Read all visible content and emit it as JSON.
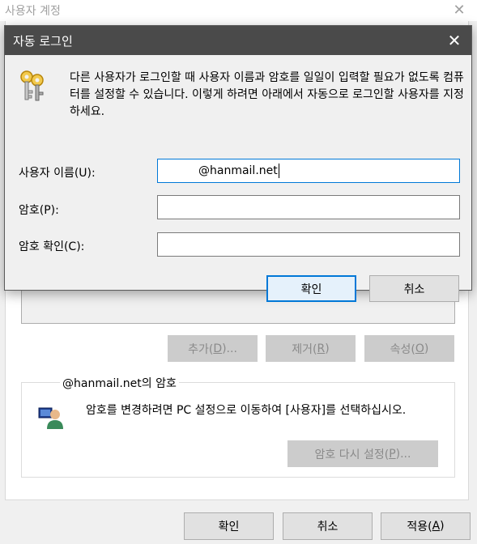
{
  "bg_window": {
    "title": "사용자 계정",
    "close_glyph": "✕",
    "buttons": {
      "add": {
        "label": "추가(",
        "key": "D",
        "suffix": ")..."
      },
      "remove": {
        "label": "제거(",
        "key": "R",
        "suffix": ")"
      },
      "properties": {
        "label": "속성(",
        "key": "O",
        "suffix": ")"
      }
    },
    "password_group": {
      "legend": "@hanmail.net의 암호",
      "text": "암호를 변경하려면 PC 설정으로 이동하여 [사용자]를 선택하십시오.",
      "reset_button": {
        "label": "암호 다시 설정(",
        "key": "P",
        "suffix": ")..."
      }
    },
    "bottom_buttons": {
      "ok": "확인",
      "cancel": "취소",
      "apply": {
        "label": "적용(",
        "key": "A",
        "suffix": ")"
      }
    }
  },
  "dialog": {
    "title": "자동 로그인",
    "close_glyph": "✕",
    "description": "다른 사용자가 로그인할 때 사용자 이름과 암호를 일일이 입력할 필요가 없도록 컴퓨터를 설정할 수 있습니다. 이렇게 하려면 아래에서 자동으로 로그인할 사용자를 지정하세요.",
    "fields": {
      "username": {
        "label": "사용자 이름(U):",
        "value": "@hanmail.net"
      },
      "password": {
        "label": "암호(P):",
        "value": ""
      },
      "confirm": {
        "label": "암호 확인(C):",
        "value": ""
      }
    },
    "ok_button": "확인",
    "cancel_button": "취소"
  }
}
